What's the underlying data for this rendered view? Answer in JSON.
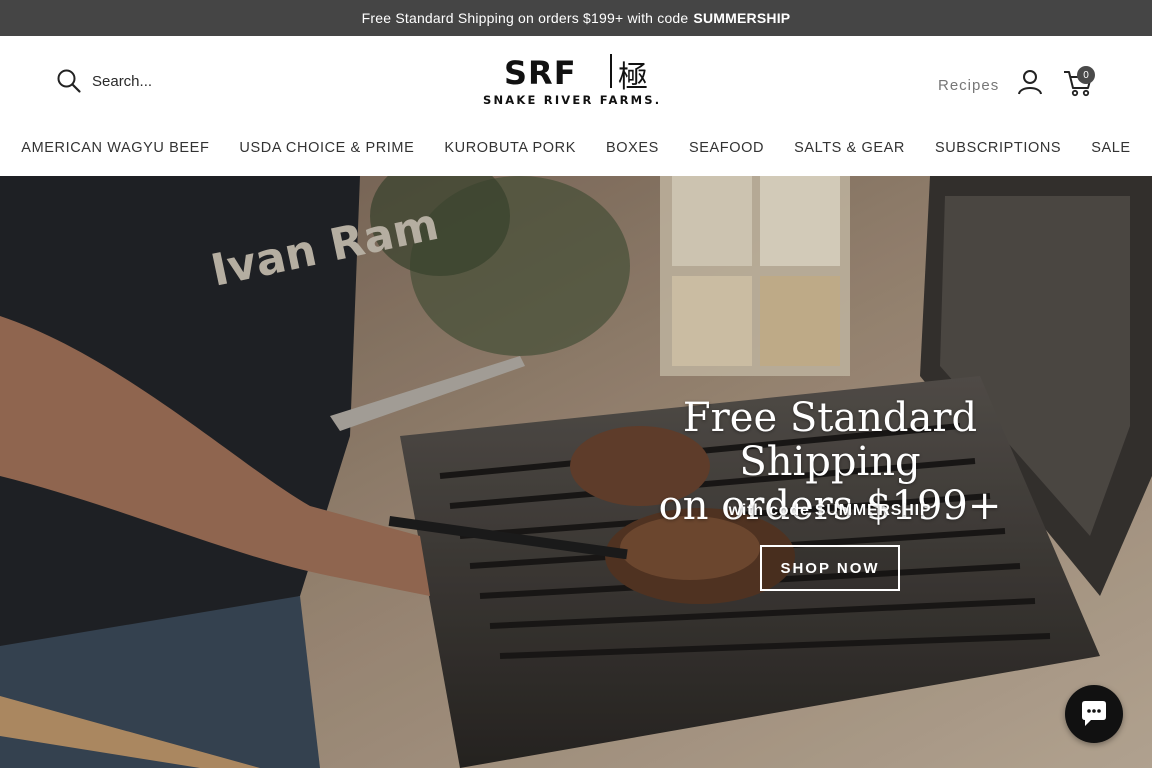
{
  "announcement": {
    "text": "Free Standard Shipping on orders $199+ with code",
    "code": "SUMMERSHIP"
  },
  "header": {
    "search_placeholder": "Search...",
    "logo": {
      "main": "SRF",
      "kanji": "極",
      "sub": "SNAKE RIVER FARMS."
    },
    "recipes_label": "Recipes",
    "cart_count": "0",
    "icons": {
      "search": "search-icon",
      "account": "user-icon",
      "cart": "cart-icon"
    }
  },
  "nav": {
    "items": [
      "AMERICAN WAGYU BEEF",
      "USDA CHOICE & PRIME",
      "KUROBUTA PORK",
      "BOXES",
      "SEAFOOD",
      "SALTS & GEAR",
      "SUBSCRIPTIONS",
      "SALE"
    ]
  },
  "hero": {
    "title_line1": "Free Standard Shipping",
    "title_line2": "on orders $199+",
    "subtitle": "with code SUMMERSHIP",
    "button": "SHOP NOW",
    "shirt_text": "Ivan Ram"
  },
  "chat": {
    "icon": "chat-icon"
  },
  "colors": {
    "announcement_bg": "#454545",
    "text_dark": "#1f1f1f",
    "recipes_gray": "#777777",
    "chat_bg": "#111111"
  }
}
